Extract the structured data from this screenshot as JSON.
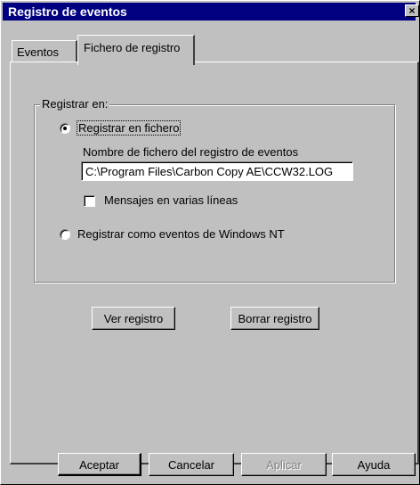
{
  "window": {
    "title": "Registro de eventos",
    "close_glyph": "×"
  },
  "tabs": [
    {
      "label": "Eventos",
      "selected": false
    },
    {
      "label": "Fichero de registro",
      "selected": true
    }
  ],
  "group": {
    "label": "Registrar en:",
    "option_file": {
      "label": "Registrar en fichero",
      "selected": true
    },
    "filename_label": "Nombre de fichero del registro de eventos",
    "filename_value": "C:\\Program Files\\Carbon Copy AE\\CCW32.LOG",
    "multiline": {
      "label": "Mensajes en varias líneas",
      "checked": false
    },
    "option_nt": {
      "label": "Registrar como eventos de Windows NT",
      "selected": false
    }
  },
  "actions": {
    "view_log": "Ver registro",
    "clear_log": "Borrar registro"
  },
  "footer": {
    "ok": "Aceptar",
    "cancel": "Cancelar",
    "apply": "Aplicar",
    "help": "Ayuda"
  },
  "colors": {
    "titlebar": "#000080",
    "face": "#c0c0c0"
  }
}
